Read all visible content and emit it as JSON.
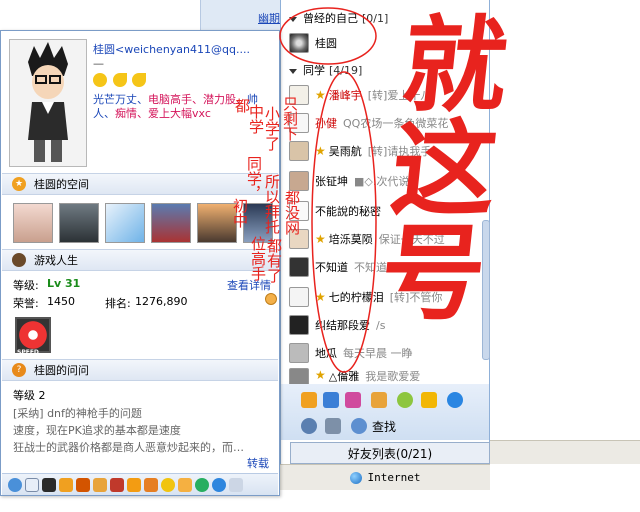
{
  "background_link": "幽期",
  "main_panel": {
    "groups": [
      {
        "label": "曾经的自己",
        "count": "[0/1]"
      },
      {
        "label": "同学",
        "count": "[4/19]"
      }
    ],
    "friends": [
      {
        "name": "桂圆",
        "signature": "",
        "star": false,
        "name_color": "#000000"
      },
      {
        "name": "潘峰宇",
        "signature": "[转]爱上十八",
        "star": true,
        "name_color": "#cc0000"
      },
      {
        "name": "孙健",
        "signature": "QQ农场一条色微菜花",
        "star": false,
        "name_color": "#cc0000"
      },
      {
        "name": "吴雨航",
        "signature": "[转]请执我手",
        "star": true,
        "name_color": "#000000"
      },
      {
        "name": "张钲坤",
        "signature": "■◇.次代说",
        "star": false,
        "name_color": "#000000"
      },
      {
        "name": "不能說的秘密",
        "signature": "",
        "star": false,
        "name_color": "#000000"
      },
      {
        "name": "培泺莫陨",
        "signature": "保证一天不过",
        "star": true,
        "name_color": "#000000"
      },
      {
        "name": "不知道",
        "signature": "不知道",
        "star": false,
        "name_color": "#000000"
      },
      {
        "name": "七的柠檬泪",
        "signature": "[转]不管你",
        "star": true,
        "name_color": "#000000"
      },
      {
        "name": "纠结那段爱",
        "signature": "/s",
        "star": false,
        "name_color": "#000000"
      },
      {
        "name": "地瓜",
        "signature": "每天早晨 一睁",
        "star": false,
        "name_color": "#000000"
      },
      {
        "name": "△倫雅",
        "signature": "我是歌爱爱",
        "star": true,
        "name_color": "#000000"
      }
    ],
    "find_label": "查找",
    "friend_list_tab": "好友列表(0/21)",
    "status": "Internet"
  },
  "profile": {
    "nickname": "桂圆",
    "email": "<weichenyan411@qq....",
    "dash": "—",
    "tags": [
      {
        "text": "光芒万丈、",
        "color": "blue"
      },
      {
        "text": "电脑高手、",
        "color": "red"
      },
      {
        "text": "潜力股、",
        "color": "red"
      },
      {
        "text": "帅人、",
        "color": "blue"
      },
      {
        "text": "痴情、",
        "color": "red"
      },
      {
        "text": "爱上大幅vxc",
        "color": "red"
      }
    ],
    "space_title": "桂圆的空间",
    "game_title": "游戏人生",
    "level_label": "等级:",
    "level_value": "Lv 31",
    "view_detail": "查看详情",
    "honor_label": "荣誉:",
    "honor_value": "1450",
    "rank_label": "排名:",
    "rank_value": "1276,890",
    "speed_logo": "SPEED",
    "qa_title": "桂圆的问问",
    "qa_level": "等级 2",
    "qa_lines": [
      "[采纳] dnf的神枪手的问题",
      "速度，现在PK追求的基本都是速度",
      "狂战士的武器价格都是商人恶意炒起来的，而…"
    ],
    "forward": "转载"
  },
  "handwriting": {
    "big": "就这号",
    "col1": "只剩下",
    "col2": "小学了",
    "col3": "初中",
    "col4": "都没网",
    "col5": "所以拜托",
    "col6": "同学，",
    "col7": "都有了",
    "col8": "位高手",
    "col9": "中学",
    "col10": "都"
  }
}
